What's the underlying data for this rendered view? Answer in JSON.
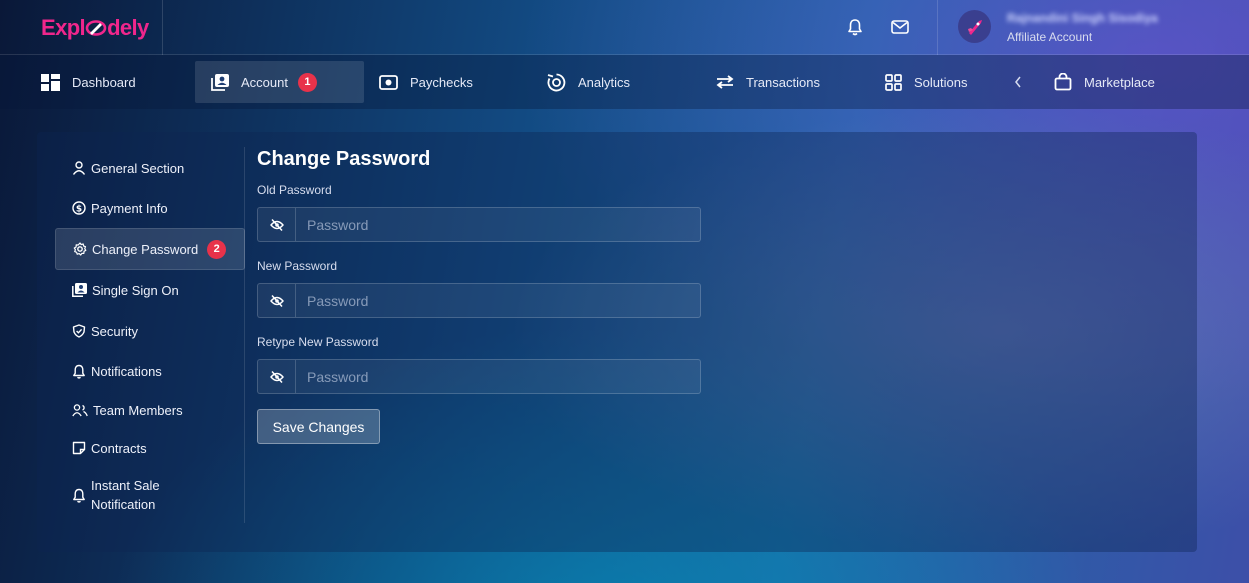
{
  "app": {
    "logo_part1": "Expl",
    "logo_part2": "dely",
    "logo_color": "#f0268c"
  },
  "header": {
    "icons": [
      "bell-icon",
      "mail-icon"
    ],
    "user": {
      "name": "Rajnandini Singh Sisodiya",
      "role": "Affiliate Account"
    }
  },
  "nav": {
    "items": [
      {
        "label": "Dashboard",
        "icon": "dashboard-icon"
      },
      {
        "label": "Account",
        "icon": "account-icon",
        "badge": "1",
        "active": true
      },
      {
        "label": "Paychecks",
        "icon": "paycheck-icon"
      },
      {
        "label": "Analytics",
        "icon": "analytics-icon"
      },
      {
        "label": "Transactions",
        "icon": "transactions-icon"
      },
      {
        "label": "Solutions",
        "icon": "solutions-icon"
      },
      {
        "label": "Marketplace",
        "icon": "bag-icon"
      }
    ],
    "collapse_icon": "chevron-left-icon"
  },
  "sidebar": {
    "items": [
      {
        "label": "General Section",
        "icon": "user-icon"
      },
      {
        "label": "Payment Info",
        "icon": "dollar-icon"
      },
      {
        "label": "Change Password",
        "icon": "gear-icon",
        "badge": "2",
        "active": true
      },
      {
        "label": "Single Sign On",
        "icon": "account-icon"
      },
      {
        "label": "Security",
        "icon": "shield-icon"
      },
      {
        "label": "Notifications",
        "icon": "bell-icon"
      },
      {
        "label": "Team Members",
        "icon": "team-icon"
      },
      {
        "label": "Contracts",
        "icon": "contract-icon"
      },
      {
        "label_line1": "Instant Sale",
        "label_line2": "Notification",
        "icon": "bell-icon"
      }
    ]
  },
  "form": {
    "title": "Change Password",
    "fields": [
      {
        "label": "Old Password",
        "placeholder": "Password",
        "value": ""
      },
      {
        "label": "New Password",
        "placeholder": "Password",
        "value": ""
      },
      {
        "label": "Retype New Password",
        "placeholder": "Password",
        "value": ""
      }
    ],
    "save_label": "Save Changes"
  },
  "colors": {
    "badge": "#e8324a",
    "accent_pink": "#f0268c"
  }
}
